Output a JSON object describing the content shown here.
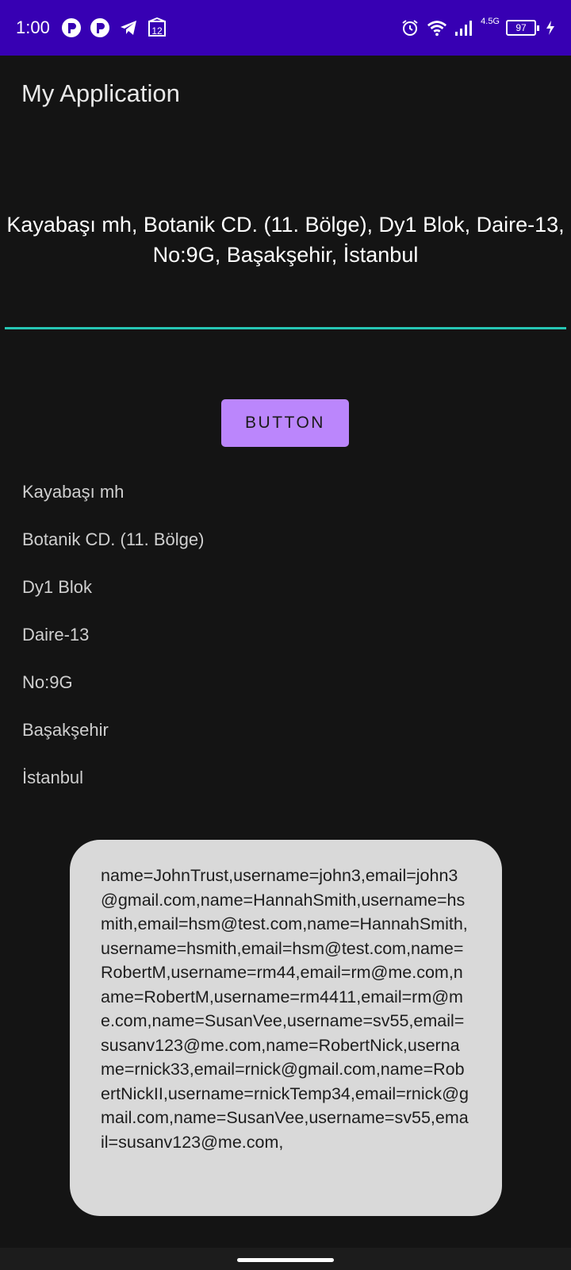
{
  "status_bar": {
    "time": "1:00",
    "notifications": [
      "p-app-icon",
      "p-app-icon",
      "telegram-icon",
      "calendar-icon"
    ],
    "calendar_day": "12",
    "network_label": "4.5G",
    "battery": "97"
  },
  "app_bar": {
    "title": "My Application"
  },
  "address_input": {
    "value": "Kayabaşı mh, Botanik CD. (11. Bölge), Dy1 Blok, Daire-13, No:9G, Başakşehir, İstanbul",
    "underline_color": "#26c6b4"
  },
  "button": {
    "label": "BUTTON",
    "color": "#bb86fc"
  },
  "address_parts": [
    "Kayabaşı mh",
    "Botanik CD. (11. Bölge)",
    "Dy1 Blok",
    "Daire-13",
    "No:9G",
    "Başakşehir",
    "İstanbul"
  ],
  "user_bubble": {
    "text": "name=JohnTrust,username=john3,email=john3@gmail.com,name=HannahSmith,username=hsmith,email=hsm@test.com,name=HannahSmith,username=hsmith,email=hsm@test.com,name=RobertM,username=rm44,email=rm@me.com,name=RobertM,username=rm4411,email=rm@me.com,name=SusanVee,username=sv55,email=susanv123@me.com,name=RobertNick,username=rnick33,email=rnick@gmail.com,name=RobertNickII,username=rnickTemp34,email=rnick@gmail.com,name=SusanVee,username=sv55,email=susanv123@me.com,"
  },
  "colors": {
    "status_bar": "#3700b3",
    "background": "#141414",
    "bubble": "#d9d9d9"
  }
}
